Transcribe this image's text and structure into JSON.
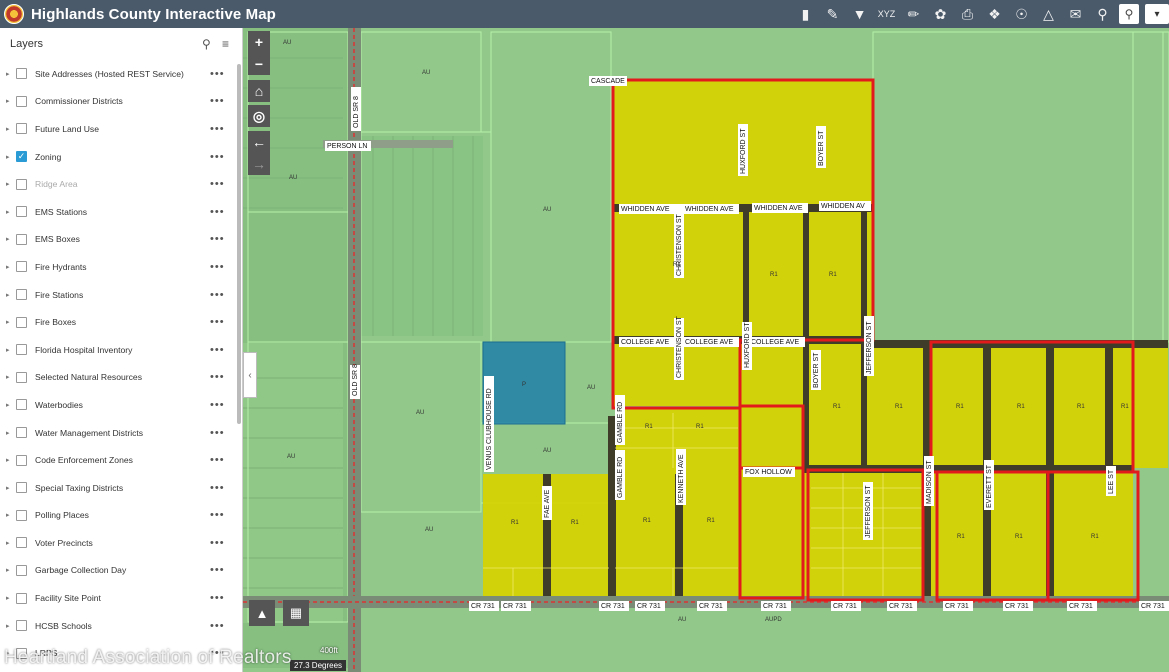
{
  "app": {
    "title": "Highlands County Interactive Map"
  },
  "toolbar": {
    "icons": [
      "bookmark-icon",
      "query-icon",
      "filter-icon",
      "coordinates-icon",
      "measure-icon",
      "layers-icon",
      "print-icon",
      "directions-icon",
      "compass-icon",
      "draw-icon",
      "email-icon",
      "zoom-search-icon",
      "search-icon",
      "dropdown-icon"
    ],
    "dropdown_label": "▾"
  },
  "layers_panel": {
    "title": "Layers",
    "items": [
      {
        "label": "Site Addresses (Hosted REST Service)",
        "checked": false,
        "dim": false
      },
      {
        "label": "Commissioner Districts",
        "checked": false,
        "dim": false
      },
      {
        "label": "Future Land Use",
        "checked": false,
        "dim": false
      },
      {
        "label": "Zoning",
        "checked": true,
        "dim": false
      },
      {
        "label": "Ridge Area",
        "checked": false,
        "dim": true
      },
      {
        "label": "EMS Stations",
        "checked": false,
        "dim": false
      },
      {
        "label": "EMS Boxes",
        "checked": false,
        "dim": false
      },
      {
        "label": "Fire Hydrants",
        "checked": false,
        "dim": false
      },
      {
        "label": "Fire Stations",
        "checked": false,
        "dim": false
      },
      {
        "label": "Fire Boxes",
        "checked": false,
        "dim": false
      },
      {
        "label": "Florida Hospital Inventory",
        "checked": false,
        "dim": false
      },
      {
        "label": "Selected Natural Resources",
        "checked": false,
        "dim": false
      },
      {
        "label": "Waterbodies",
        "checked": false,
        "dim": false
      },
      {
        "label": "Water Management Districts",
        "checked": false,
        "dim": false
      },
      {
        "label": "Code Enforcement Zones",
        "checked": false,
        "dim": false
      },
      {
        "label": "Special Taxing Districts",
        "checked": false,
        "dim": false
      },
      {
        "label": "Polling Places",
        "checked": false,
        "dim": false
      },
      {
        "label": "Voter Precincts",
        "checked": false,
        "dim": false
      },
      {
        "label": "Garbage Collection Day",
        "checked": false,
        "dim": false
      },
      {
        "label": "Facility Site Point",
        "checked": false,
        "dim": false
      },
      {
        "label": "HCSB Schools",
        "checked": false,
        "dim": false
      },
      {
        "label": "LRPS",
        "checked": false,
        "dim": false
      }
    ]
  },
  "map_controls": {
    "zoom_in": "+",
    "zoom_out": "−",
    "home": "⌂",
    "locate": "◎",
    "back": "←",
    "forward": "→",
    "collapse": "‹"
  },
  "map": {
    "streets": {
      "old_sr8": "OLD SR 8",
      "person_ln": "PERSON LN",
      "cascade": "CASCADE",
      "whidden_ave": "WHIDDEN AVE",
      "whidden_av": "WHIDDEN AV",
      "christenson_st": "CHRISTENSON ST",
      "huxford_st": "HUXFORD ST",
      "boyer_st": "BOYER ST",
      "college_ave": "COLLEGE AVE",
      "jefferson_st": "JEFFERSON ST",
      "venus_clubhouse_rd": "VENUS CLUBHOUSE RD",
      "gamble_rd": "GAMBLE RD",
      "kenneth_ave": "KENNETH AVE",
      "fae_ave": "FAE AVE",
      "fox_hollow": "FOX HOLLOW",
      "madison_st": "MADISON ST",
      "everett_st": "EVERETT ST",
      "lee_st": "LEE ST",
      "cr731": "CR 731"
    },
    "zones": {
      "r1": "R1",
      "au": "AU",
      "aupd": "AUPD",
      "p": "P"
    },
    "scale_label": "400ft",
    "coordinates": "27.3 Degrees"
  },
  "watermark": "Heartland Association of Realtors",
  "bottom_buttons": [
    "basemap-icon",
    "grid-icon"
  ],
  "colors": {
    "header": "#4a5a6b",
    "zoning_yellow": "#d9d300",
    "selection_red": "#e31a1c",
    "blue_parcel": "#1f7fa8",
    "map_green": "#8fce8a",
    "checkbox_on": "#2a9bd4"
  }
}
